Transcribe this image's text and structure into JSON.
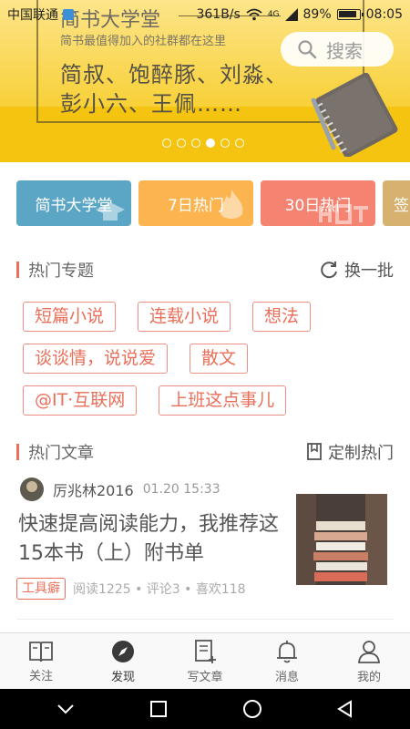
{
  "status_bar": {
    "carrier": "中国联通",
    "network_speed": "361B/s",
    "signal_label": "4G",
    "battery": "89%",
    "time": "08:05"
  },
  "banner": {
    "title": "简书大学堂",
    "subtitle": "简书最值得加入的社群都在这里",
    "line1": "简叔、饱醉豚、刘淼、",
    "line2": "彭小六、王佩……",
    "search_label": "搜索",
    "active_slide": 4,
    "slide_count": 6
  },
  "categories": [
    {
      "label": "简书大学堂",
      "color": "#5ba6c4"
    },
    {
      "label": "7日热门",
      "color": "#fbb450"
    },
    {
      "label": "30日热门",
      "color": "#f48372"
    },
    {
      "label": "签",
      "color": "#d6b16f"
    }
  ],
  "hot_topics": {
    "title": "热门专题",
    "action": "换一批",
    "rows": [
      [
        "短篇小说",
        "连载小说",
        "想法"
      ],
      [
        "谈谈情，说说爱",
        "散文"
      ],
      [
        "@IT·互联网",
        "上班这点事儿"
      ]
    ]
  },
  "hot_articles": {
    "title": "热门文章",
    "action": "定制热门",
    "article": {
      "author": "厉兆林2016",
      "time": "01.20 15:33",
      "title": "快速提高阅读能力，我推荐这15本书（上）附书单",
      "tag": "工具癖",
      "stats": "阅读1225 • 评论3 • 喜欢118"
    }
  },
  "tabbar": {
    "follow": "关注",
    "discover": "发现",
    "write": "写文章",
    "messages": "消息",
    "me": "我的"
  },
  "colors": {
    "accent": "#ea6f5a",
    "banner_yellow": "#f6c915"
  }
}
